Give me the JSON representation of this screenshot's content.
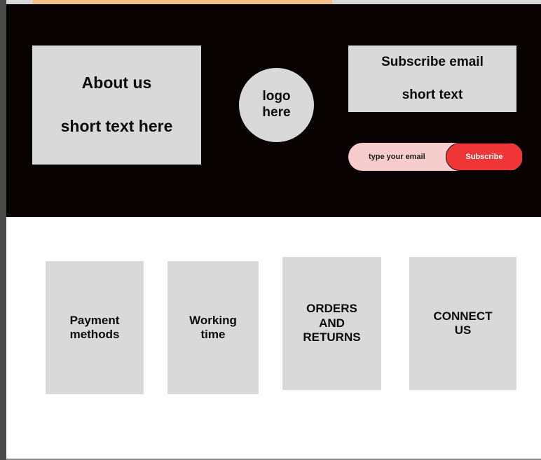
{
  "footer": {
    "about": {
      "title": "About us",
      "text": "short text here"
    },
    "logo": {
      "line1": "logo",
      "line2": "here"
    },
    "subscribe": {
      "title": "Subscribe email",
      "text": "short text",
      "email_placeholder": "type your email",
      "button_label": "Subscribe"
    }
  },
  "cards": [
    {
      "line1": "Payment",
      "line2": "methods"
    },
    {
      "line1": "Working",
      "line2": "time"
    },
    {
      "line1": "ORDERS",
      "line2": "AND",
      "line3": "RETURNS"
    },
    {
      "line1": "CONNECT",
      "line2": "US"
    }
  ],
  "colors": {
    "footer_bg": "#080203",
    "box_bg": "#d9d9d9",
    "email_bg": "#f6cccc",
    "subscribe_button": "#ef3535",
    "top_accent": "#f5bf8a"
  }
}
